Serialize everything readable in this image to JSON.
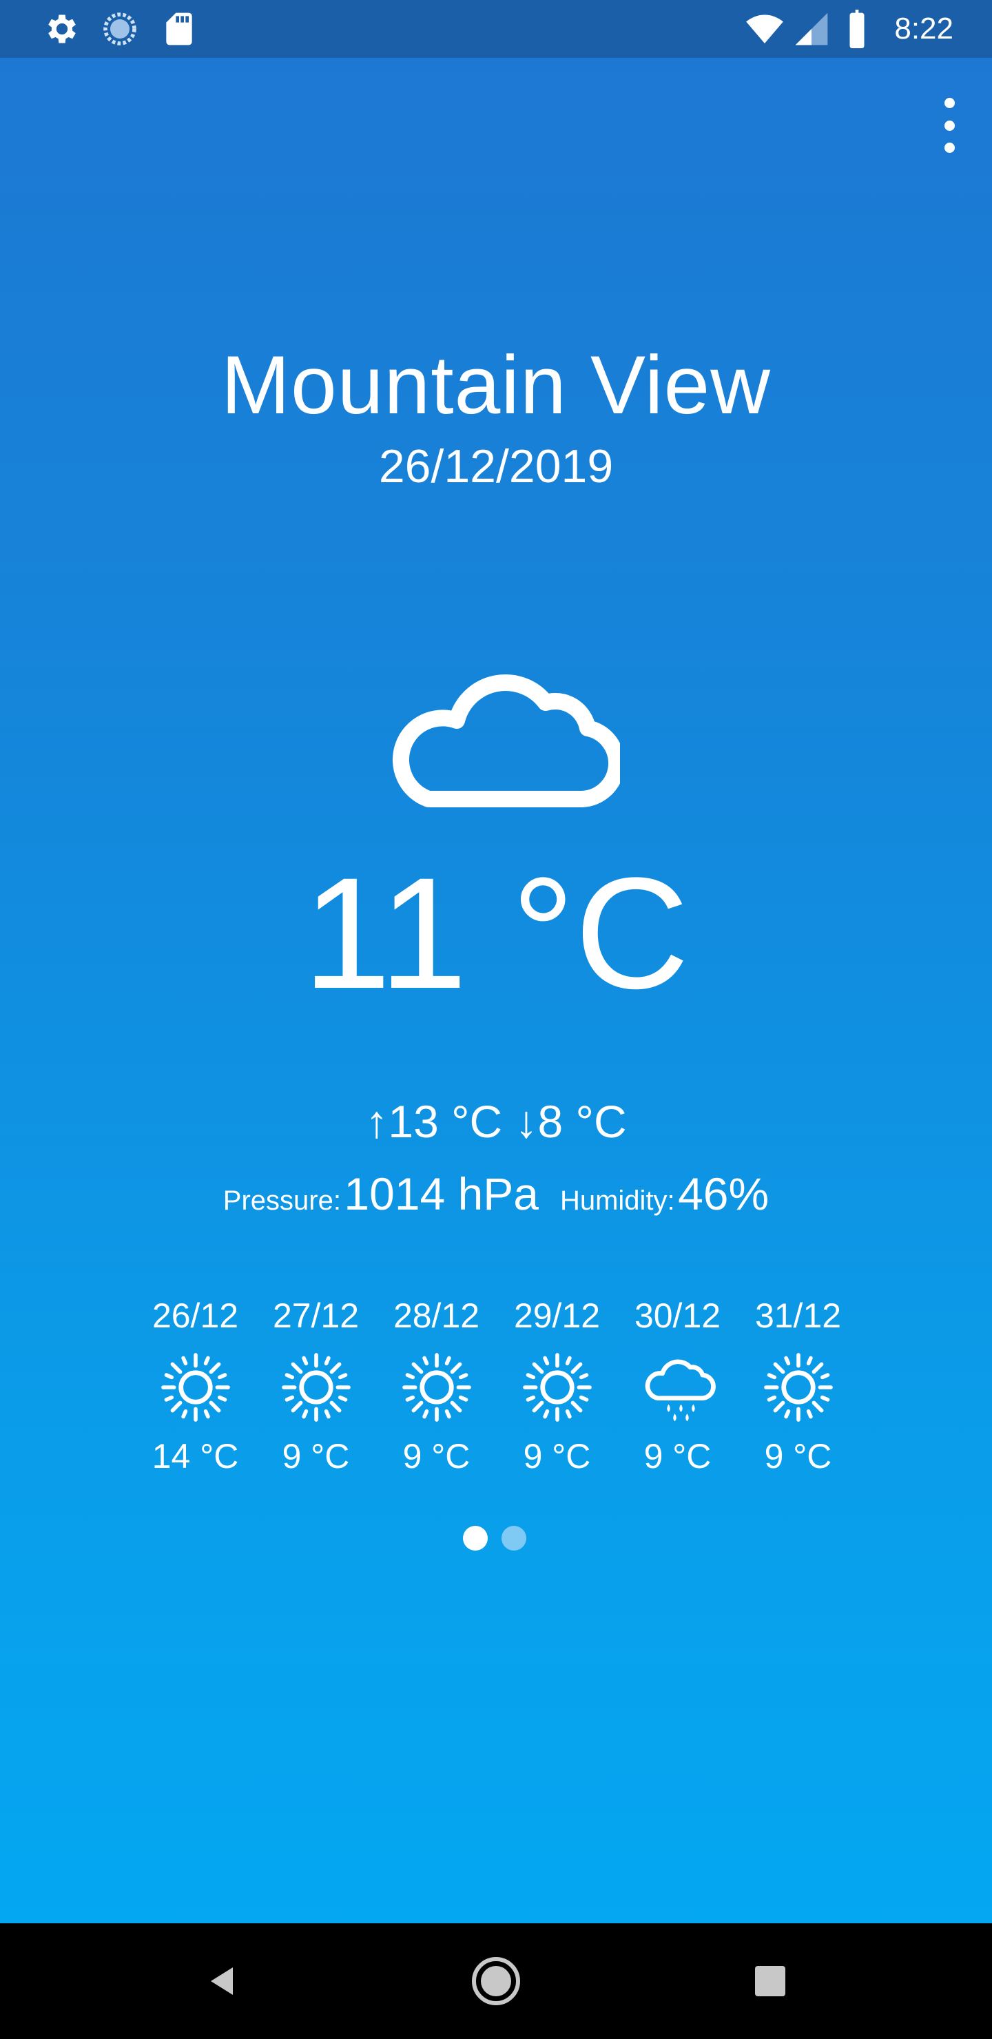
{
  "status_bar": {
    "time": "8:22",
    "icons": [
      "settings-icon",
      "sync-icon",
      "sd-card-icon",
      "wifi-icon",
      "signal-icon",
      "battery-icon"
    ]
  },
  "toolbar": {
    "menu_icon": "more-vert-icon"
  },
  "current": {
    "city": "Mountain View",
    "date": "26/12/2019",
    "condition_icon": "cloud-icon",
    "temperature": "11 °C",
    "high": "↑13 °C",
    "low": "↓8 °C",
    "pressure_label": "Pressure:",
    "pressure_value": "1014 hPa",
    "humidity_label": "Humidity:",
    "humidity_value": "46%"
  },
  "forecast": [
    {
      "date": "26/12",
      "icon": "sun-icon",
      "temp": "14 °C"
    },
    {
      "date": "27/12",
      "icon": "sun-icon",
      "temp": "9 °C"
    },
    {
      "date": "28/12",
      "icon": "sun-icon",
      "temp": "9 °C"
    },
    {
      "date": "29/12",
      "icon": "sun-icon",
      "temp": "9 °C"
    },
    {
      "date": "30/12",
      "icon": "rain-cloud-icon",
      "temp": "9 °C"
    },
    {
      "date": "31/12",
      "icon": "sun-icon",
      "temp": "9 °C"
    }
  ],
  "pager": {
    "page_count": 2,
    "active_index": 0
  },
  "nav_bar": {
    "buttons": [
      "back-icon",
      "home-icon",
      "recents-icon"
    ]
  },
  "colors": {
    "status_bar": "#1a5fa8",
    "background_top": "#1e77d2",
    "background_bottom": "#04a7f2",
    "text": "#ffffff",
    "pager_active": "#ffffff",
    "pager_inactive": "#7fcaf5"
  }
}
